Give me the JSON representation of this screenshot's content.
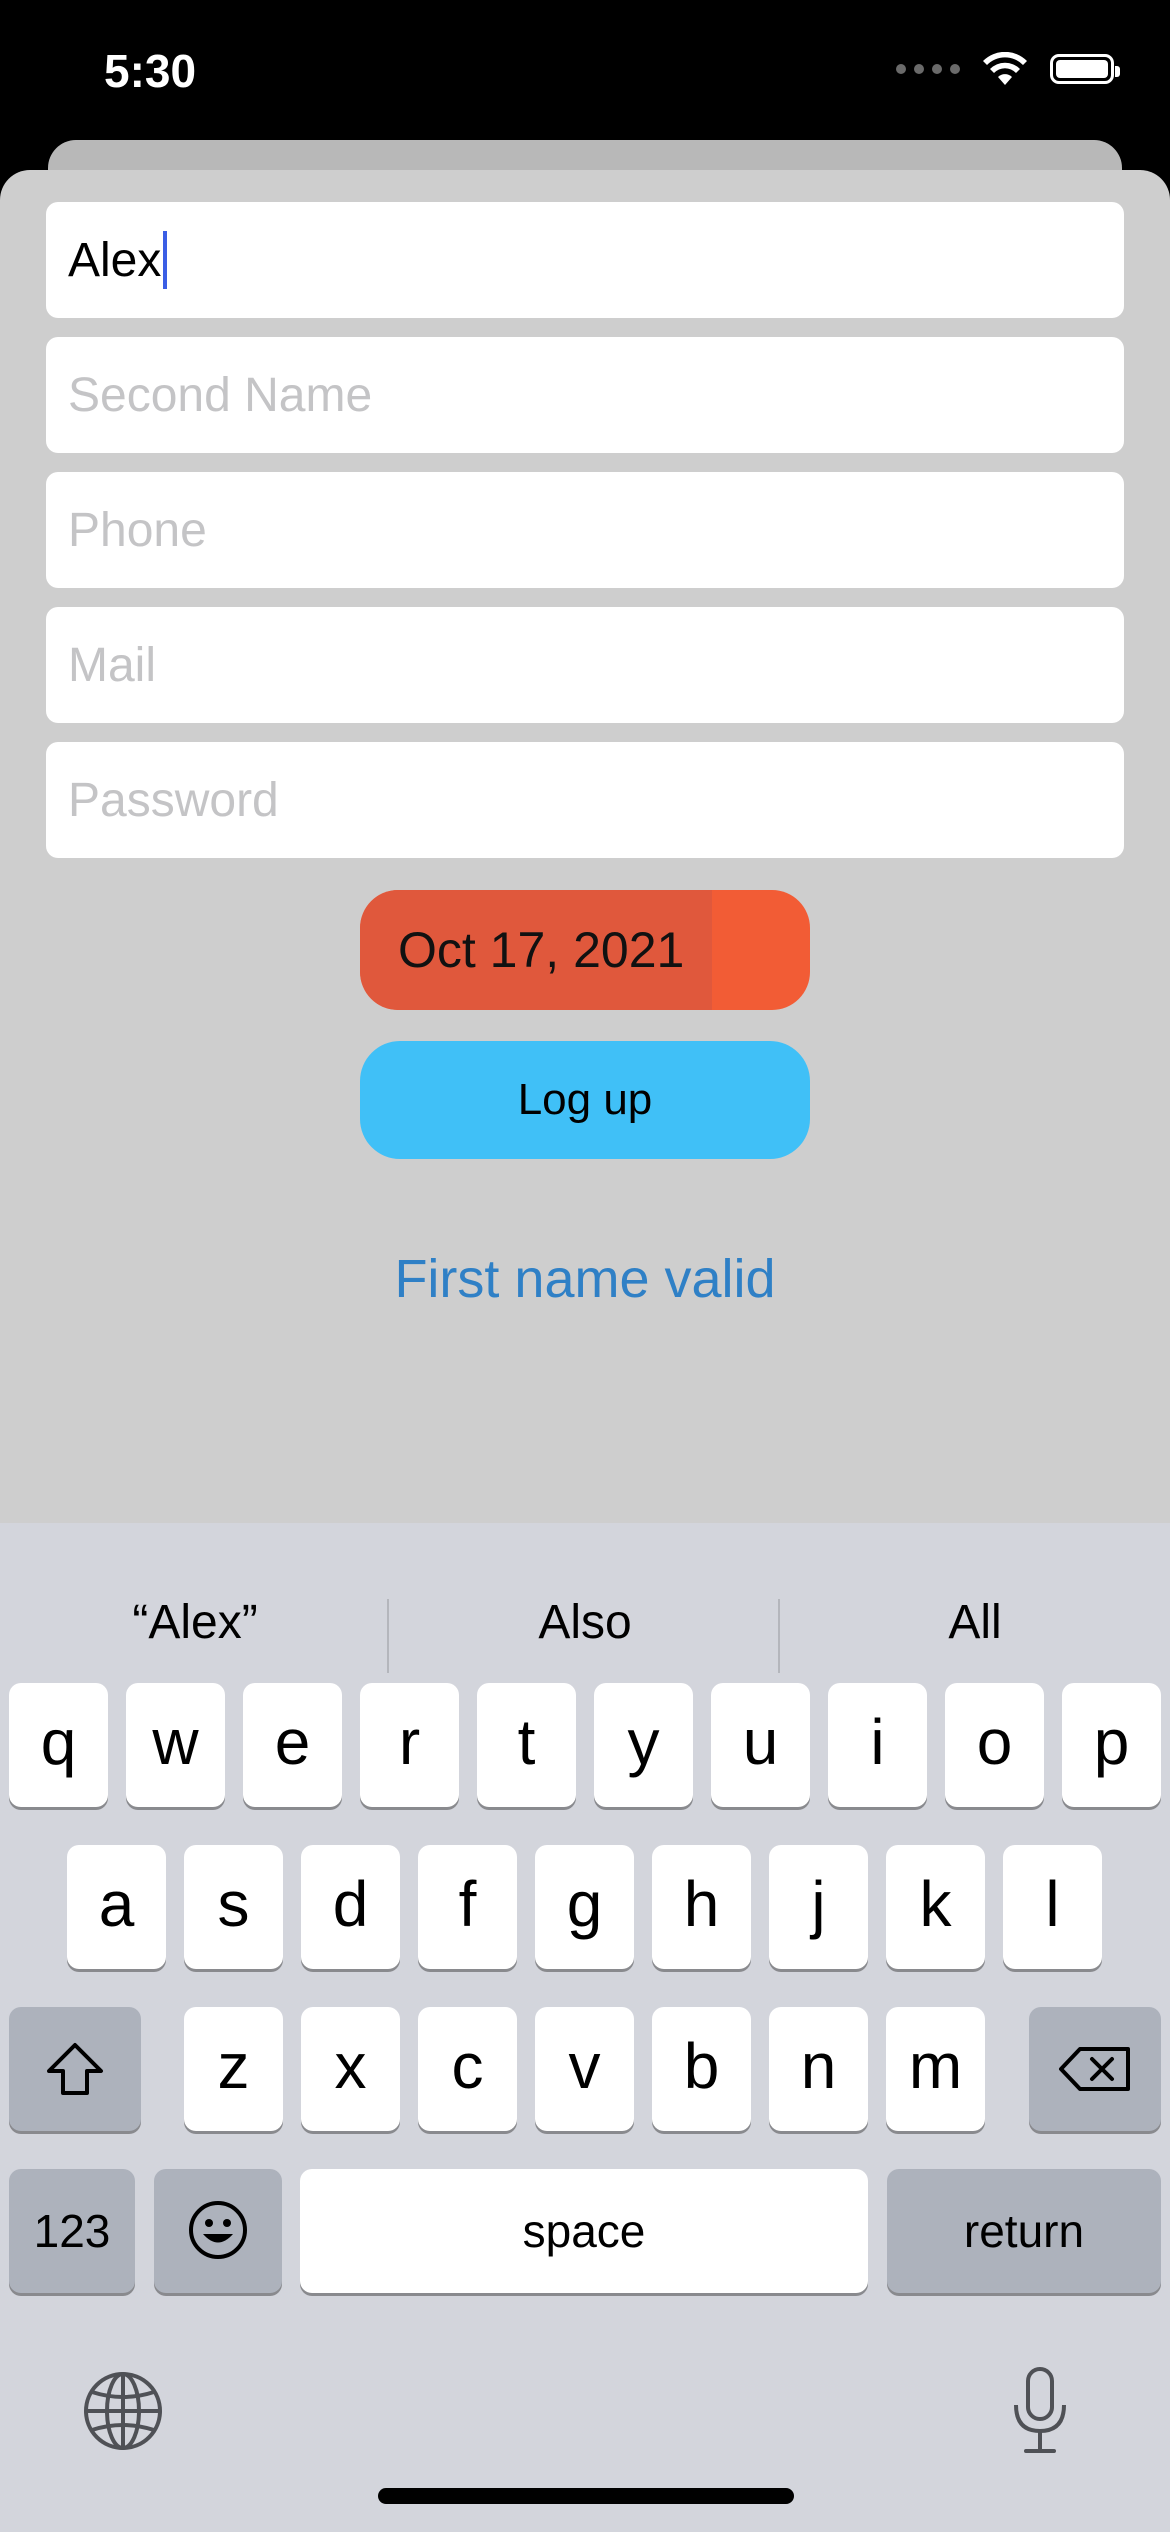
{
  "status": {
    "time": "5:30"
  },
  "form": {
    "first_name_value": "Alex",
    "second_name_placeholder": "Second Name",
    "phone_placeholder": "Phone",
    "mail_placeholder": "Mail",
    "password_placeholder": "Password",
    "date_value": "Oct 17, 2021",
    "logup_label": "Log up",
    "validation_message": "First name valid"
  },
  "keyboard": {
    "suggestions": [
      "“Alex”",
      "Also",
      "All"
    ],
    "row1": [
      "q",
      "w",
      "e",
      "r",
      "t",
      "y",
      "u",
      "i",
      "o",
      "p"
    ],
    "row2": [
      "a",
      "s",
      "d",
      "f",
      "g",
      "h",
      "j",
      "k",
      "l"
    ],
    "row3": [
      "z",
      "x",
      "c",
      "v",
      "b",
      "n",
      "m"
    ],
    "numbers_label": "123",
    "space_label": "space",
    "return_label": "return"
  },
  "colors": {
    "date_pill": "#f25c35",
    "logup_button": "#40c0f7",
    "validation_text": "#2f80c6",
    "caret": "#3b5ee5"
  },
  "icons": [
    "wifi-icon",
    "battery-icon",
    "shift-icon",
    "backspace-icon",
    "emoji-icon",
    "globe-icon",
    "microphone-icon"
  ]
}
